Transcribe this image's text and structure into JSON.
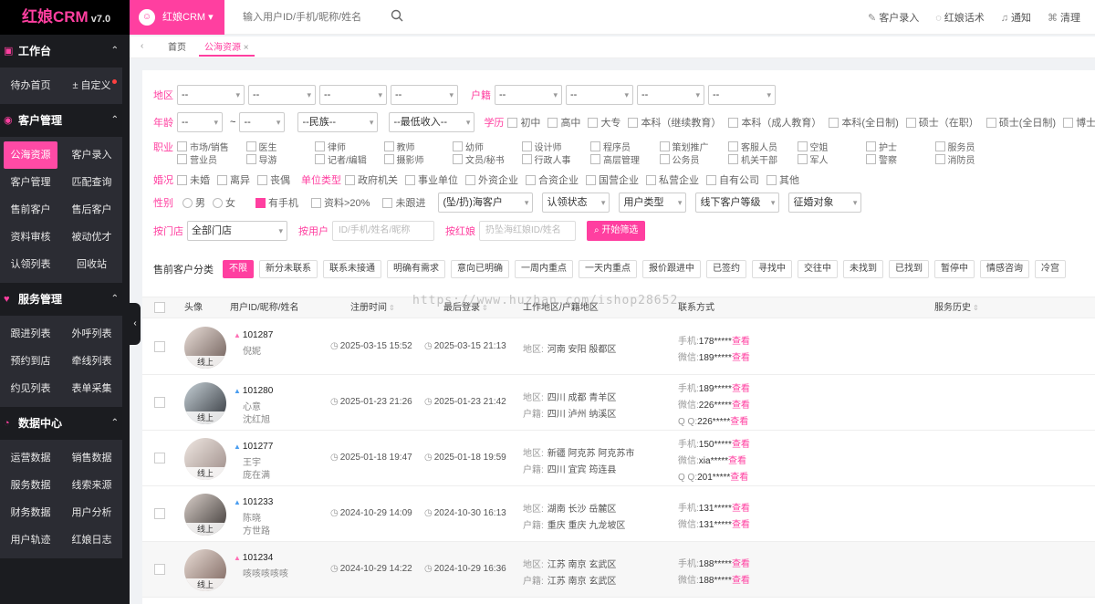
{
  "brand": {
    "name": "红娘CRM",
    "version": "v7.0"
  },
  "sidebar": {
    "sections": [
      {
        "title": "工作台",
        "icon": "dashboard-icon",
        "items": [
          "待办首页",
          "自定义"
        ]
      },
      {
        "title": "客户管理",
        "icon": "user-icon",
        "items": [
          "公海资源",
          "客户录入",
          "客户管理",
          "匹配查询",
          "售前客户",
          "售后客户",
          "资料审核",
          "被动优才",
          "认领列表",
          "回收站"
        ]
      },
      {
        "title": "服务管理",
        "icon": "heart-icon",
        "items": [
          "跟进列表",
          "外呼列表",
          "预约到店",
          "牵线列表",
          "约见列表",
          "表单采集"
        ]
      },
      {
        "title": "数据中心",
        "icon": "pie-chart-icon",
        "items": [
          "运营数据",
          "销售数据",
          "服务数据",
          "线索来源",
          "财务数据",
          "用户分析",
          "用户轨迹",
          "红娘日志"
        ]
      }
    ]
  },
  "topbar": {
    "team": "红娘CRM",
    "search_placeholder": "输入用户ID/手机/昵称/姓名",
    "actions": [
      "客户录入",
      "红娘话术",
      "通知",
      "清理"
    ]
  },
  "tabs": {
    "items": [
      "首页",
      "公海资源"
    ],
    "active": "公海资源",
    "close": "×"
  },
  "filters": {
    "region_label": "地区",
    "huji_label": "户籍",
    "age_label": "年龄",
    "edu_label": "学历",
    "job_label": "职业",
    "marriage_label": "婚况",
    "unit_label": "单位类型",
    "gender_label": "性别",
    "store_label": "按门店",
    "user_label": "按用户",
    "matchmaker_label": "按红娘",
    "dash": "--",
    "tilde": "~",
    "nation": "--民族--",
    "income": "--最低收入--",
    "education": [
      "初中",
      "高中",
      "大专",
      "本科（继续教育）",
      "本科（成人教育）",
      "本科(全日制)",
      "硕士（在职）",
      "硕士(全日制)",
      "博士"
    ],
    "jobs": [
      "市场/销售",
      "医生",
      "律师",
      "教师",
      "幼师",
      "设计师",
      "程序员",
      "策划推广",
      "客服人员",
      "空姐",
      "护士",
      "服务员",
      "营业员",
      "导游",
      "记者/编辑",
      "摄影师",
      "文员/秘书",
      "行政人事",
      "高层管理",
      "公务员",
      "机关干部",
      "军人",
      "警察",
      "消防员"
    ],
    "marriage": [
      "未婚",
      "离异",
      "丧偶"
    ],
    "units": [
      "政府机关",
      "事业单位",
      "外资企业",
      "合资企业",
      "国营企业",
      "私营企业",
      "自有公司",
      "其他"
    ],
    "gender": [
      "男",
      "女"
    ],
    "flags": [
      "有手机",
      "资料>20%",
      "未跟进"
    ],
    "dropdowns": [
      "(坠/扔)海客户",
      "认领状态",
      "用户类型",
      "线下客户等级",
      "征婚对象"
    ],
    "store": "全部门店",
    "user_placeholder": "ID/手机/姓名/昵称",
    "matchmaker_placeholder": "扔坠海红娘ID/姓名",
    "search_btn": "开始筛选"
  },
  "categories": {
    "label": "售前客户分类",
    "items": [
      "不限",
      "新分未联系",
      "联系未接通",
      "明确有需求",
      "意向已明确",
      "一周内重点",
      "一天内重点",
      "报价跟进中",
      "已签约",
      "寻找中",
      "交往中",
      "未找到",
      "已找到",
      "暂停中",
      "情感咨询",
      "冷宫"
    ]
  },
  "table": {
    "headers": [
      "头像",
      "用户ID/昵称/姓名",
      "注册时间",
      "最后登录",
      "工作地区/户籍地区",
      "联系方式",
      "服务历史"
    ],
    "rows": [
      {
        "id": "101287",
        "gender": "female",
        "nick": "倪妮",
        "name": "",
        "reg": "2025-03-15 15:52",
        "last": "2025-03-15 21:13",
        "area": "河南 安阳 殷都区",
        "huji": "",
        "phone": "178*****",
        "wechat": "189*****",
        "qq": "",
        "status": "线上"
      },
      {
        "id": "101280",
        "gender": "male",
        "nick": "心意",
        "name": "沈红旭",
        "reg": "2025-01-23 21:26",
        "last": "2025-01-23 21:42",
        "area": "四川 成都 青羊区",
        "huji": "四川 泸州 纳溪区",
        "phone": "189*****",
        "wechat": "226*****",
        "qq": "226*****",
        "status": "线上"
      },
      {
        "id": "101277",
        "gender": "male",
        "nick": "王宇",
        "name": "庞在满",
        "reg": "2025-01-18 19:47",
        "last": "2025-01-18 19:59",
        "area": "新疆 阿克苏 阿克苏市",
        "huji": "四川 宜宾 筠连县",
        "phone": "150*****",
        "wechat": "xia*****",
        "qq": "201*****",
        "status": "线上"
      },
      {
        "id": "101233",
        "gender": "male",
        "nick": "陈晓",
        "name": "方世路",
        "reg": "2024-10-29 14:09",
        "last": "2024-10-30 16:13",
        "area": "湖南 长沙 岳麓区",
        "huji": "重庆 重庆 九龙坡区",
        "phone": "131*****",
        "wechat": "131*****",
        "qq": "",
        "status": "线上"
      },
      {
        "id": "101234",
        "gender": "female",
        "nick": "咳咳咳咳咳",
        "name": "",
        "reg": "2024-10-29 14:22",
        "last": "2024-10-29 16:36",
        "area": "江苏 南京 玄武区",
        "huji": "江苏 南京 玄武区",
        "phone": "188*****",
        "wechat": "188*****",
        "qq": "",
        "status": "线上"
      }
    ],
    "labels": {
      "area": "地区:",
      "huji": "户籍:",
      "phone": "手机:",
      "wechat": "微信:",
      "qq": "Q Q:",
      "view": "查看"
    }
  },
  "watermark": "https://www.huzhan.com/ishop28652",
  "colors": {
    "accent": "#ff3fa0",
    "sidebar": "#1b1c20"
  }
}
